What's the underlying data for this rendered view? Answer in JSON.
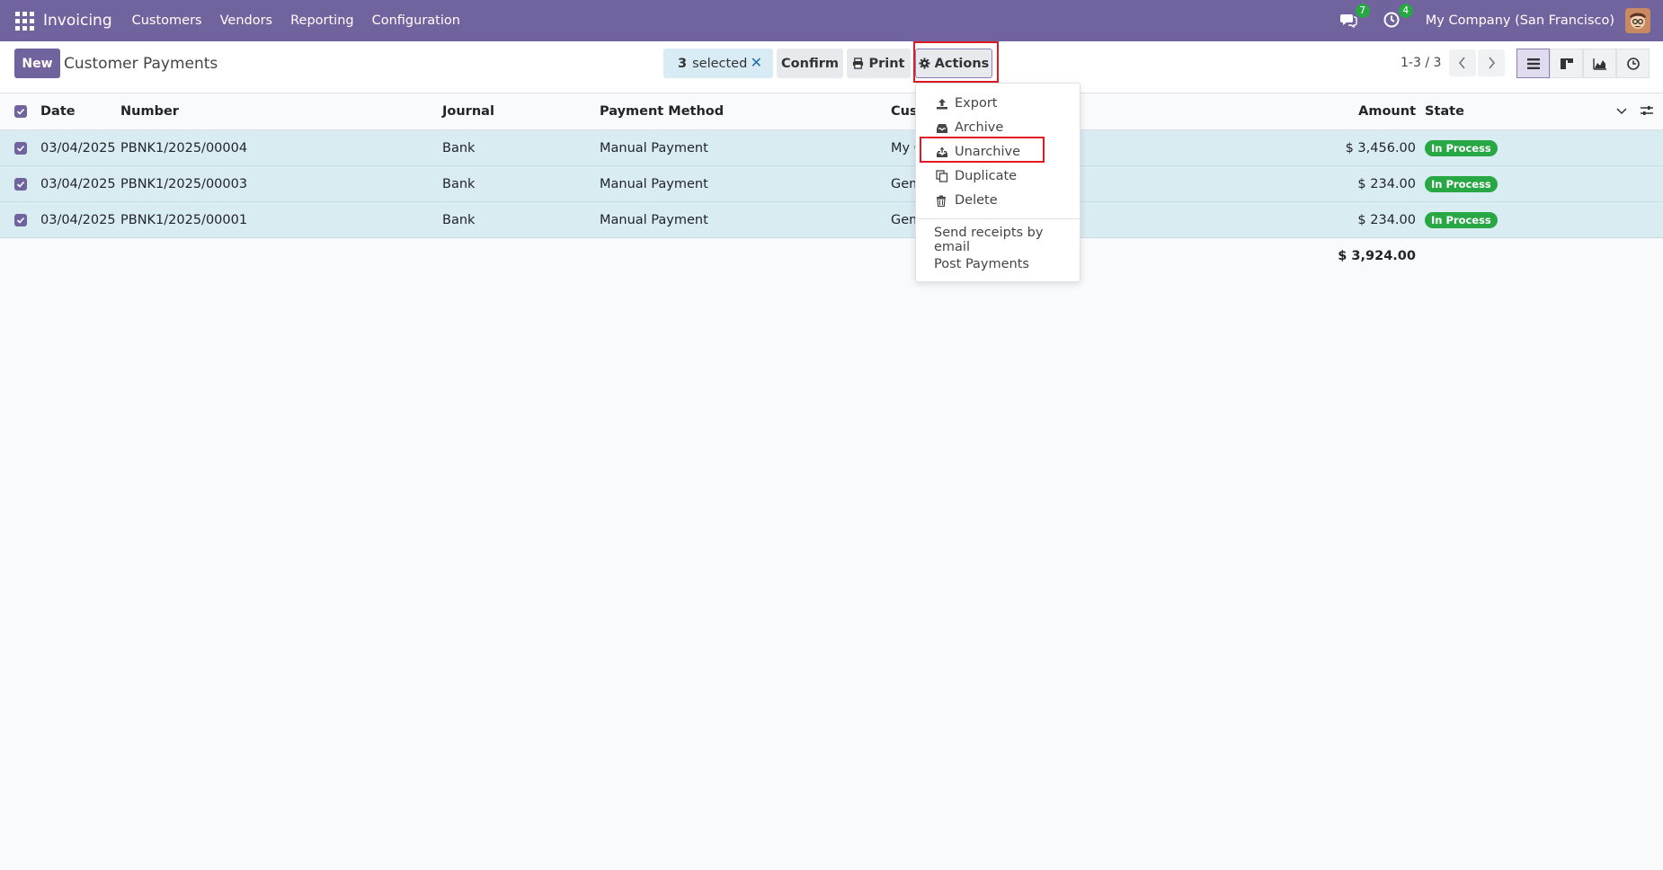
{
  "navbar": {
    "app_name": "Invoicing",
    "menu": [
      "Customers",
      "Vendors",
      "Reporting",
      "Configuration"
    ],
    "messages_count": "7",
    "activities_count": "4",
    "company": "My Company (San Francisco)"
  },
  "control_panel": {
    "new_label": "New",
    "title": "Customer Payments",
    "selected_count": "3",
    "selected_label": "selected",
    "confirm_label": "Confirm",
    "print_label": "Print",
    "actions_label": "Actions",
    "pager": "1-3 / 3"
  },
  "table": {
    "headers": {
      "date": "Date",
      "number": "Number",
      "journal": "Journal",
      "payment_method": "Payment Method",
      "customer": "Cust",
      "amount": "Amount",
      "state": "State"
    },
    "rows": [
      {
        "date": "03/04/2025",
        "number": "PBNK1/2025/00004",
        "journal": "Bank",
        "payment_method": "Manual Payment",
        "customer": "My C",
        "amount": "$ 3,456.00",
        "state": "In Process"
      },
      {
        "date": "03/04/2025",
        "number": "PBNK1/2025/00003",
        "journal": "Bank",
        "payment_method": "Manual Payment",
        "customer": "Gem",
        "amount": "$ 234.00",
        "state": "In Process"
      },
      {
        "date": "03/04/2025",
        "number": "PBNK1/2025/00001",
        "journal": "Bank",
        "payment_method": "Manual Payment",
        "customer": "Gem",
        "amount": "$ 234.00",
        "state": "In Process"
      }
    ],
    "total": "$ 3,924.00"
  },
  "actions_menu": {
    "export": "Export",
    "archive": "Archive",
    "unarchive": "Unarchive",
    "duplicate": "Duplicate",
    "delete": "Delete",
    "send_receipts": "Send receipts by email",
    "post_payments": "Post Payments"
  },
  "colors": {
    "brand": "#71639e",
    "selected_row": "#d9ecf1",
    "status_green": "#28a745",
    "highlight": "#e01b24"
  }
}
